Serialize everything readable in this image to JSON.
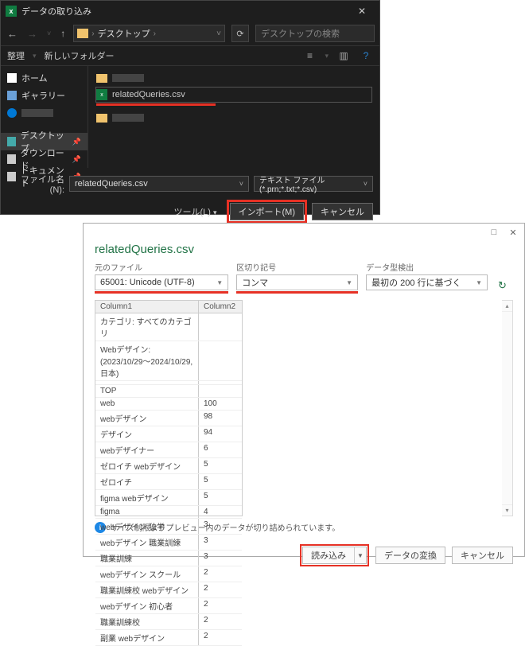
{
  "filedlg": {
    "title": "データの取り込み",
    "path_crumb": "デスクトップ",
    "search_placeholder": "デスクトップの検索",
    "toolbar": {
      "organize": "整理",
      "new_folder": "新しいフォルダー"
    },
    "sidebar": {
      "home": "ホーム",
      "gallery": "ギャラリー",
      "cloud": "",
      "desktop": "デスクトップ",
      "downloads": "ダウンロード",
      "documents": "ドキュメント"
    },
    "files": {
      "selected": "relatedQueries.csv"
    },
    "filename_label": "ファイル名(N):",
    "filename_value": "relatedQueries.csv",
    "filetype_value": "テキスト ファイル (*.prn;*.txt;*.csv)",
    "tools_label": "ツール(L)",
    "import_btn": "インポート(M)",
    "cancel_btn": "キャンセル"
  },
  "pq": {
    "title": "relatedQueries.csv",
    "opts": {
      "origin_label": "元のファイル",
      "origin_value": "65001: Unicode (UTF-8)",
      "delimiter_label": "区切り記号",
      "delimiter_value": "コンマ",
      "detect_label": "データ型検出",
      "detect_value": "最初の 200 行に基づく"
    },
    "cols": {
      "c1": "Column1",
      "c2": "Column2"
    },
    "rows": [
      {
        "c1": "カテゴリ: すべてのカテゴリ",
        "c2": ""
      },
      {
        "c1": "Webデザイン: (2023/10/29～2024/10/29, 日本)",
        "c2": ""
      },
      {
        "c1": "",
        "c2": ""
      },
      {
        "c1": "TOP",
        "c2": ""
      },
      {
        "c1": "web",
        "c2": "100"
      },
      {
        "c1": "webデザイン",
        "c2": "98"
      },
      {
        "c1": "デザイン",
        "c2": "94"
      },
      {
        "c1": "webデザイナー",
        "c2": "6"
      },
      {
        "c1": "ゼロイチ webデザイン",
        "c2": "5"
      },
      {
        "c1": "ゼロイチ",
        "c2": "5"
      },
      {
        "c1": "figma webデザイン",
        "c2": "5"
      },
      {
        "c1": "figma",
        "c2": "4"
      },
      {
        "c1": "webデザイン 独学",
        "c2": "3"
      },
      {
        "c1": "webデザイン 職業訓練",
        "c2": "3"
      },
      {
        "c1": "職業訓練",
        "c2": "3"
      },
      {
        "c1": "webデザイン スクール",
        "c2": "2"
      },
      {
        "c1": "職業訓練校 webデザイン",
        "c2": "2"
      },
      {
        "c1": "webデザイン 初心者",
        "c2": "2"
      },
      {
        "c1": "職業訓練校",
        "c2": "2"
      },
      {
        "c1": "副業 webデザイン",
        "c2": "2"
      }
    ],
    "info_text": "サイズ制限よりプレビュー内のデータが切り詰められています。",
    "load_btn": "読み込み",
    "transform_btn": "データの変換",
    "cancel_btn": "キャンセル"
  }
}
